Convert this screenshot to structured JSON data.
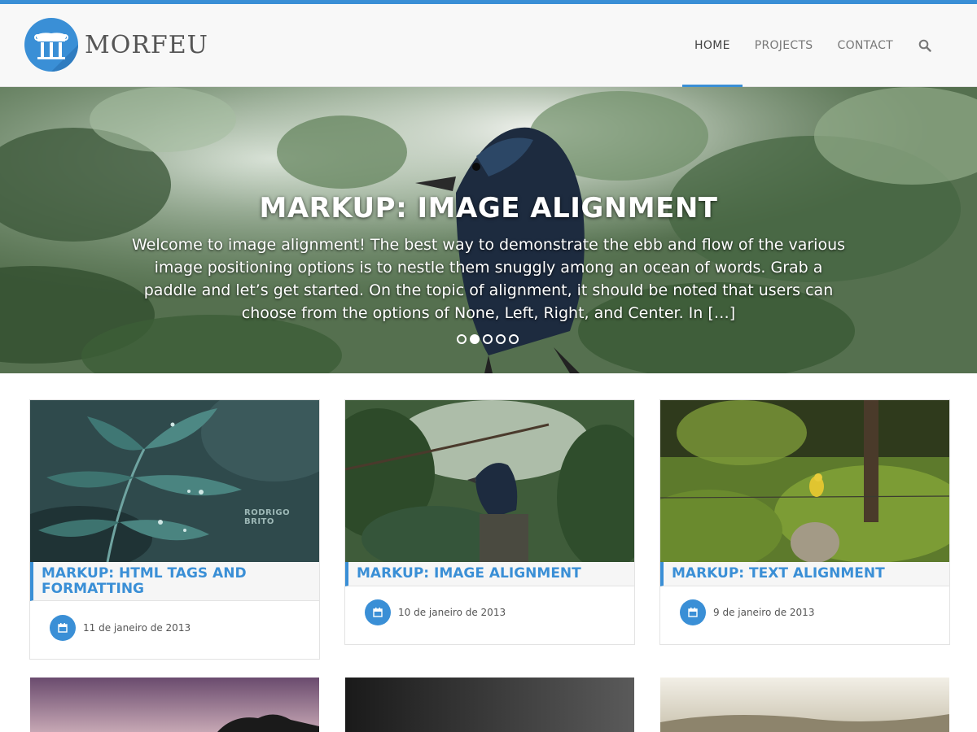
{
  "site": {
    "logo_text": "MORFEU",
    "logo_icon": "pillar-logo-icon"
  },
  "nav": {
    "items": [
      {
        "label": "HOME",
        "active": true
      },
      {
        "label": "PROJECTS",
        "active": false
      },
      {
        "label": "CONTACT",
        "active": false
      }
    ],
    "search_icon": "search-icon"
  },
  "hero": {
    "title": "MARKUP: IMAGE ALIGNMENT",
    "excerpt": "Welcome to image alignment! The best way to demonstrate the ebb and flow of the various image positioning options is to nestle them snuggly among an ocean of words. Grab a paddle and let’s get started. On the topic of alignment, it should be noted that users can choose from the options of None, Left, Right, and Center. In […]",
    "slide_count": 5,
    "active_slide": 2
  },
  "posts": [
    {
      "title": "MARKUP: HTML TAGS AND FORMATTING",
      "date": "11 de janeiro de 2013",
      "watermark": "RODRIGO BRITO"
    },
    {
      "title": "MARKUP: IMAGE ALIGNMENT",
      "date": "10 de janeiro de 2013"
    },
    {
      "title": "MARKUP: TEXT ALIGNMENT",
      "date": "9 de janeiro de 2013"
    }
  ],
  "colors": {
    "accent": "#3a8fd6",
    "header_bg": "#f8f8f8"
  }
}
